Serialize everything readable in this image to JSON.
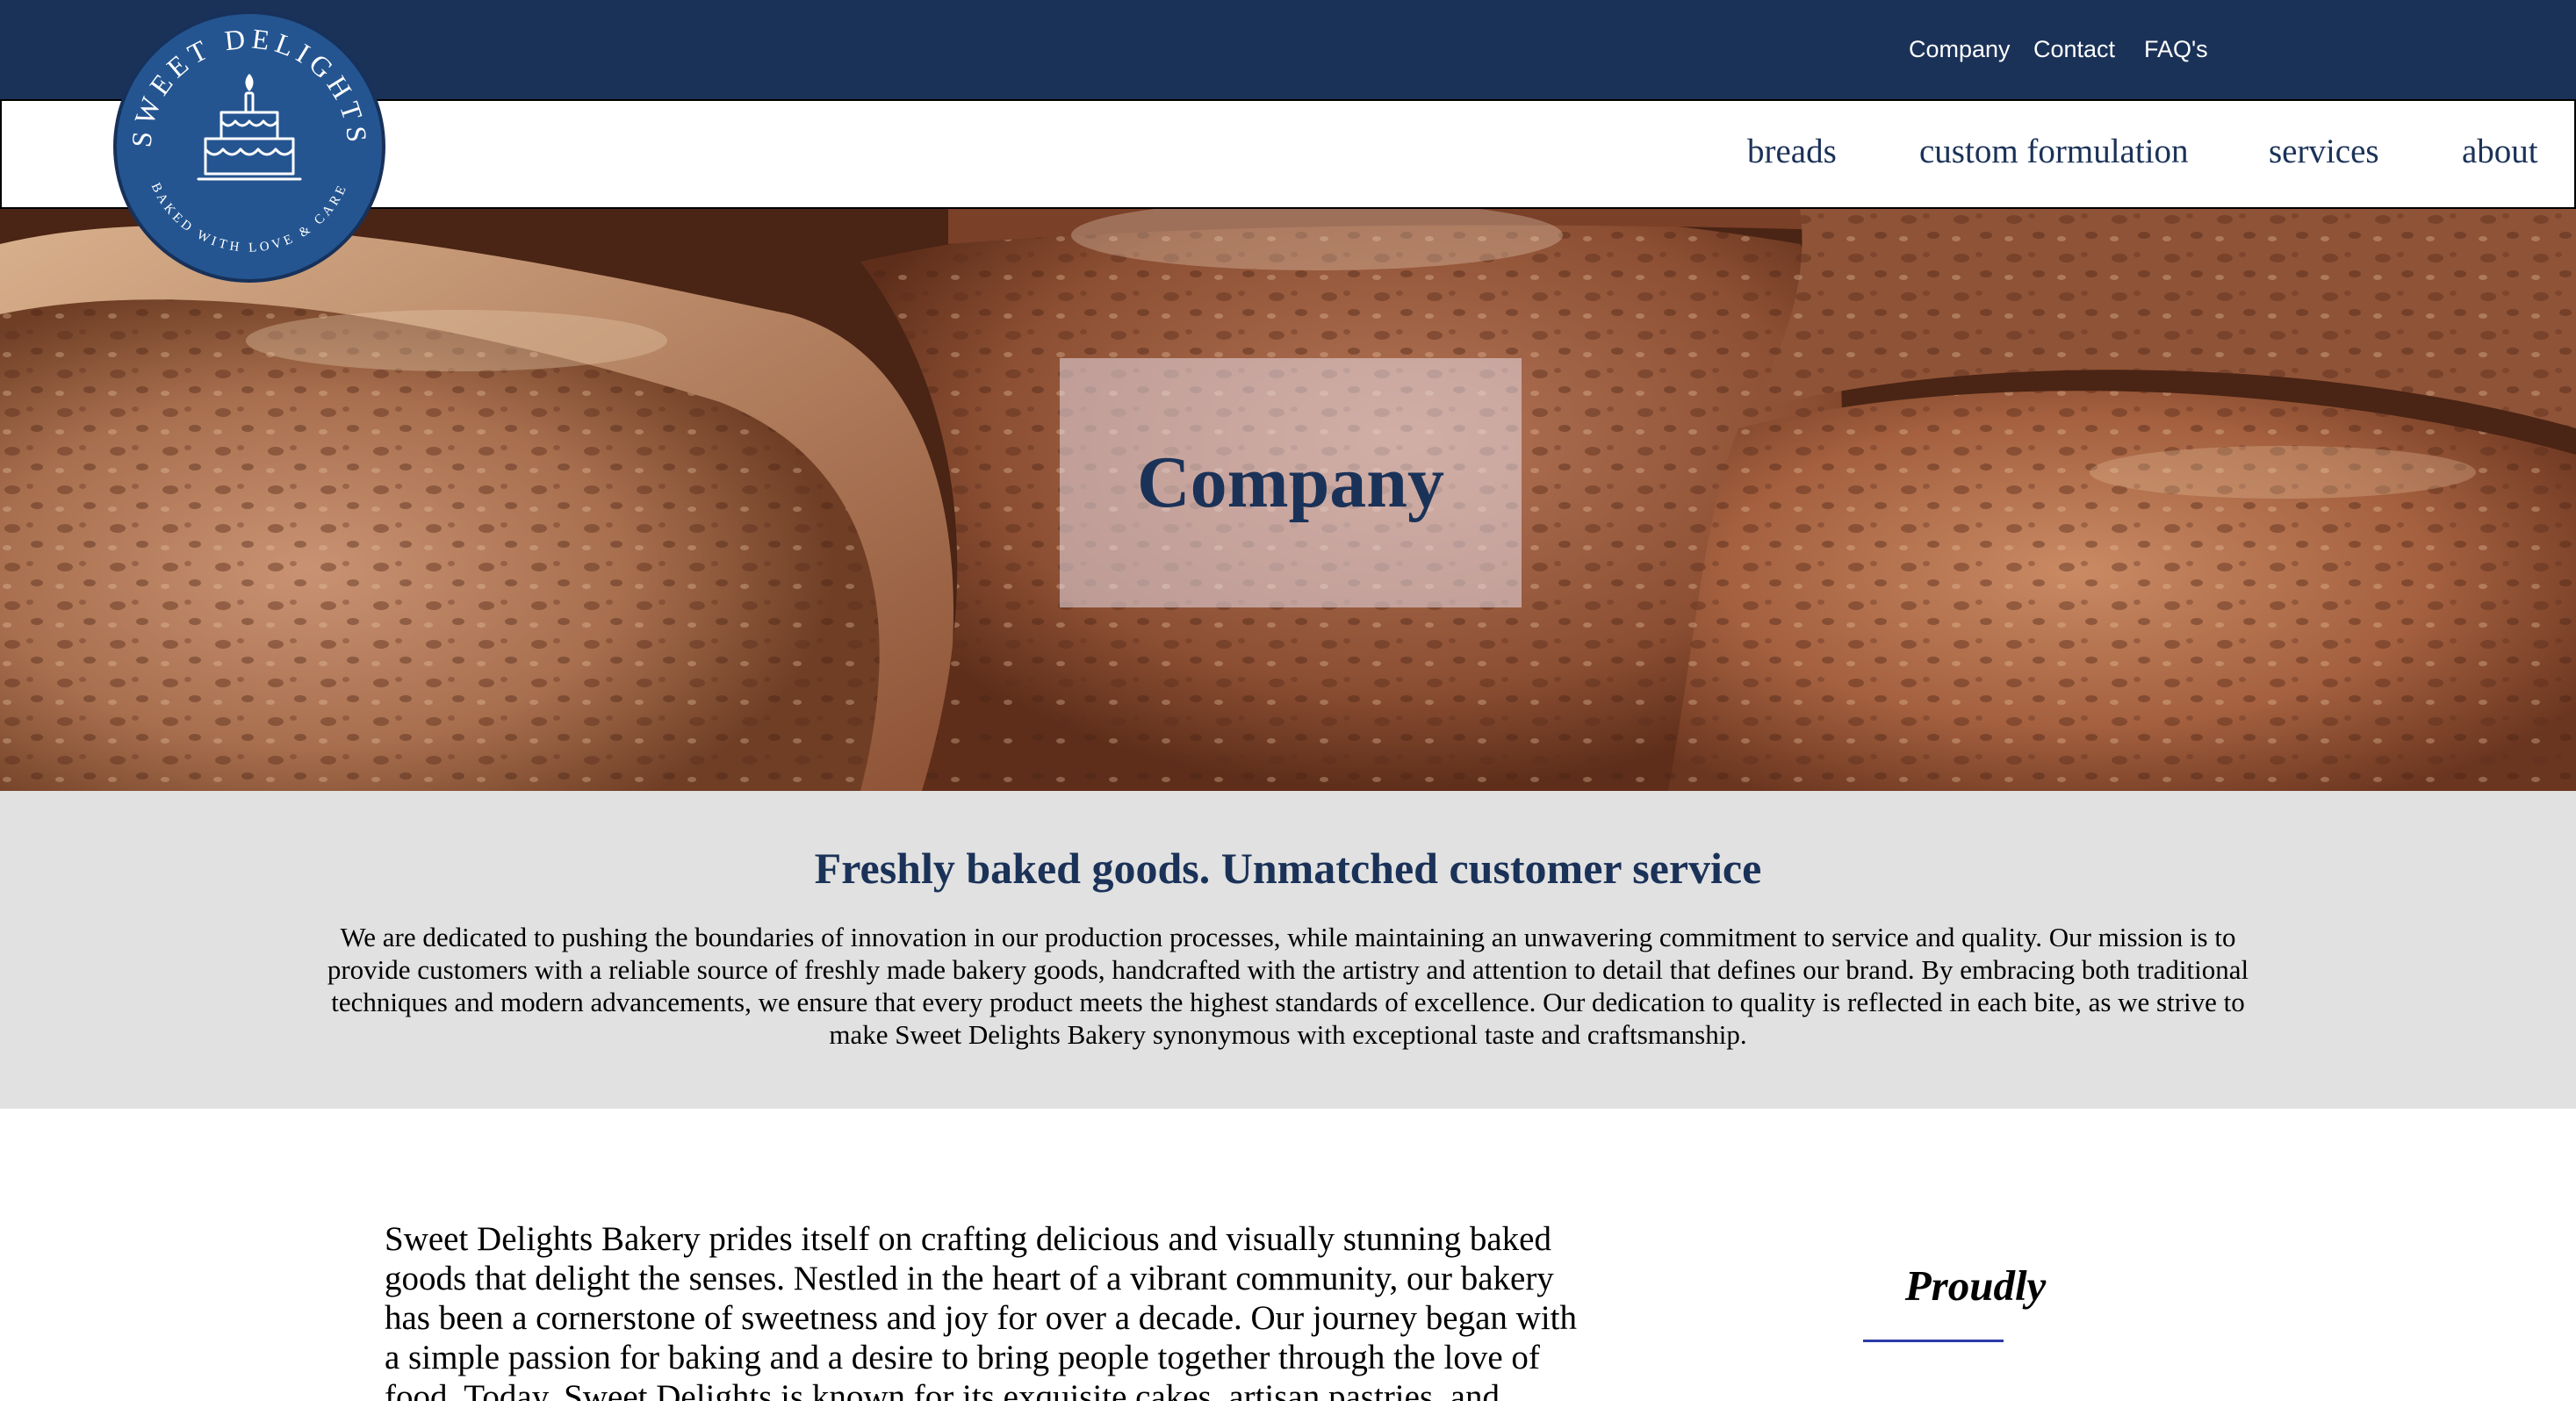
{
  "topbar": {
    "links": [
      "Company",
      "Contact",
      "FAQ's"
    ]
  },
  "logo": {
    "name_text": "SWEET DELIGHTS",
    "tagline_text": "BAKED WITH LOVE & CARE",
    "icon": "cake-icon",
    "colors": {
      "fill": "#245591",
      "ring": "#17315a",
      "art": "#ffffff"
    }
  },
  "nav": {
    "items": [
      "breads",
      "custom formulation",
      "services",
      "about"
    ]
  },
  "hero": {
    "title": "Company",
    "background_image": "artisan-bread-loaves"
  },
  "mission": {
    "heading": "Freshly baked goods. Unmatched customer service",
    "body": "We are dedicated to pushing the boundaries of innovation in our production processes, while maintaining an unwavering commitment to service and quality. Our mission is to provide customers with a reliable source of freshly made bakery goods, handcrafted with the artistry and attention to detail that defines our brand. By embracing both traditional techniques and modern advancements, we ensure that every product meets the highest standards of excellence. Our dedication to quality is reflected in each bite, as we strive to make Sweet Delights Bakery synonymous with exceptional taste and craftsmanship."
  },
  "story": {
    "text": "Sweet Delights Bakery prides itself on crafting delicious and visually stunning baked goods that delight the senses. Nestled in the heart of a vibrant community, our bakery has been a cornerstone of sweetness and joy for over a decade. Our journey began with a simple passion for baking and a desire to bring people together through the love of food. Today, Sweet Delights is known for its exquisite cakes, artisan pastries, and mouth-"
  },
  "aside": {
    "title": "Proudly"
  },
  "colors": {
    "navy": "#1b3258",
    "mission_bg": "#e1e1e1",
    "accent_rule": "#2b3aa6"
  }
}
